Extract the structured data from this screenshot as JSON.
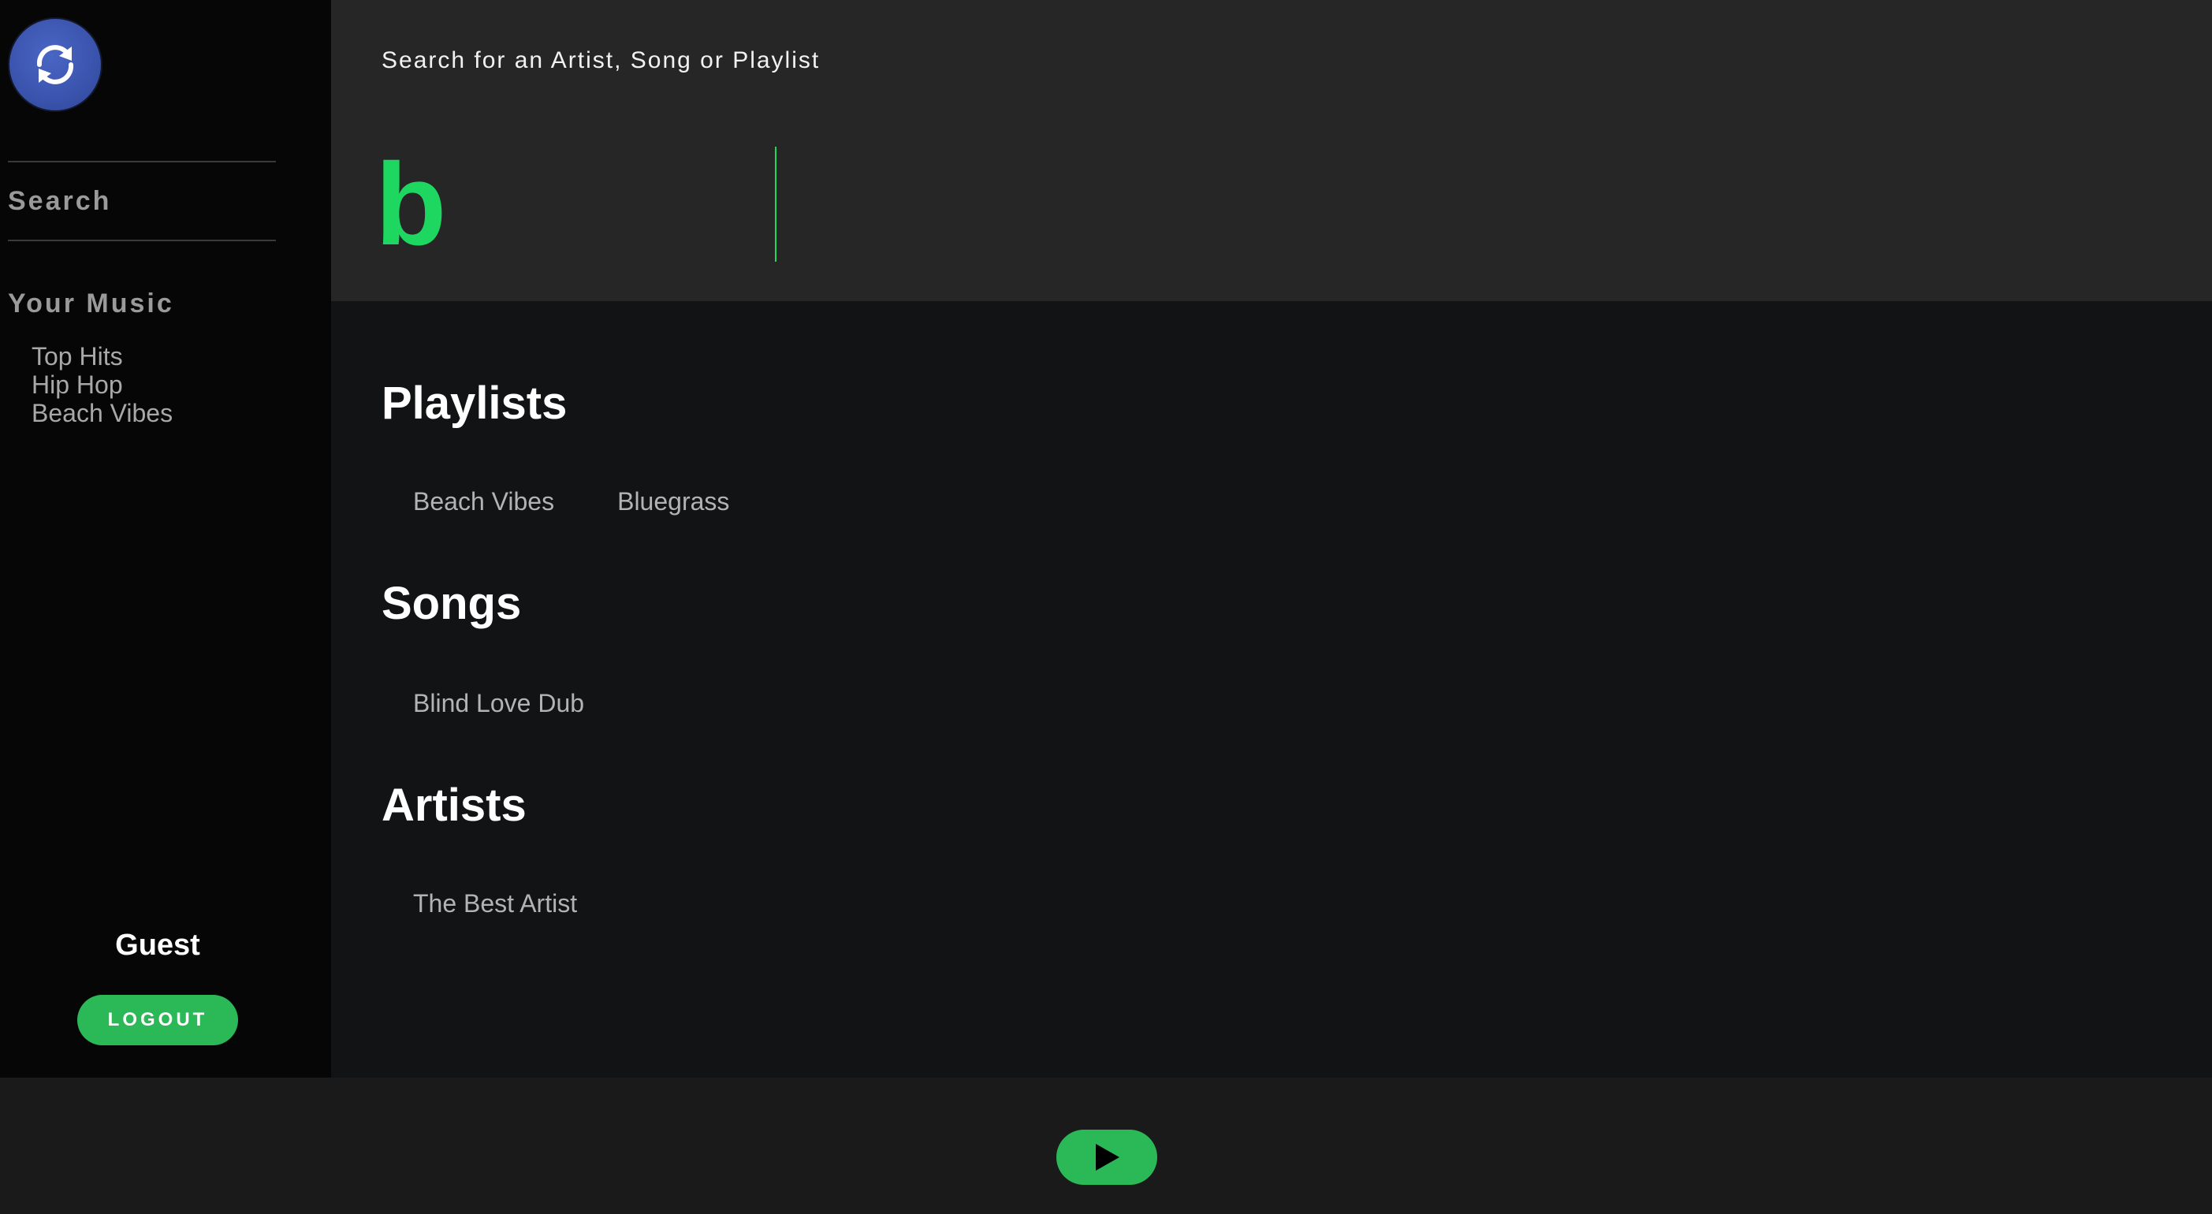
{
  "sidebar": {
    "nav_search": "Search",
    "your_music_title": "Your Music",
    "playlists": [
      "Top Hits",
      "Hip Hop",
      "Beach Vibes"
    ],
    "user_name": "Guest",
    "logout_label": "LOGOUT"
  },
  "header": {
    "search_label": "Search for an Artist, Song or Playlist",
    "search_value": "b"
  },
  "results": {
    "playlists_title": "Playlists",
    "playlists": [
      "Beach Vibes",
      "Bluegrass"
    ],
    "songs_title": "Songs",
    "songs": [
      "Blind Love Dub"
    ],
    "artists_title": "Artists",
    "artists": [
      "The Best Artist"
    ]
  },
  "colors": {
    "accent": "#1ed760",
    "button": "#2bb856",
    "logo": "#3a54ad"
  },
  "icons": {
    "logo": "refresh-icon",
    "player": "play-icon"
  }
}
